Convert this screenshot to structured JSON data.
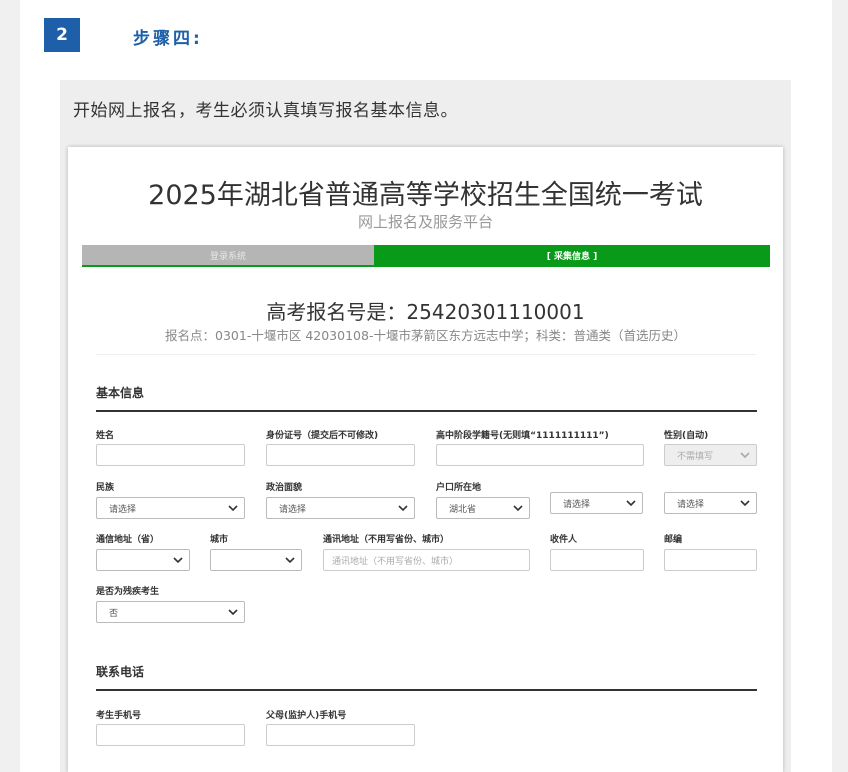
{
  "step": {
    "number": "2",
    "title": "步骤四:"
  },
  "intro": "开始网上报名，考生必须认真填写报名基本信息。",
  "platform": {
    "title": "2025年湖北省普通高等学校招生全国统一考试",
    "subtitle": "网上报名及服务平台"
  },
  "progress": {
    "step1": "登录系统",
    "step2": "[ 采集信息 ]"
  },
  "registration": {
    "number_text": "高考报名号是：25420301110001",
    "info_text": "报名点：0301-十堰市区 42030108-十堰市茅箭区东方远志中学；科类：普通类（首选历史）"
  },
  "basic": {
    "section_title": "基本信息",
    "name_label": "姓名",
    "id_label": "身份证号（提交后不可修改)",
    "school_id_label": "高中阶段学籍号(无则填“1111111111”)",
    "gender_label": "性别(自动)",
    "gender_value": "不需填写",
    "ethnicity_label": "民族",
    "ethnicity_value": "请选择",
    "politics_label": "政治面貌",
    "politics_value": "请选择",
    "hukou_label": "户口所在地",
    "hukou_province": "湖北省",
    "hukou_city": "请选择",
    "hukou_county": "请选择",
    "addr_province_label": "通信地址（省）",
    "city_label": "城市",
    "address_label": "通讯地址（不用写省份、城市）",
    "address_placeholder": "通讯地址（不用写省份、城市）",
    "recipient_label": "收件人",
    "postcode_label": "邮编",
    "disabled_label": "是否为残疾考生",
    "disabled_value": "否"
  },
  "contact": {
    "section_title": "联系电话",
    "mobile_label": "考生手机号",
    "parent_mobile_label": "父母(监护人)手机号"
  },
  "colors": {
    "accent_blue": "#1d5fa8",
    "progress_green": "#0a9a19",
    "progress_gray": "#b5b5b5"
  }
}
